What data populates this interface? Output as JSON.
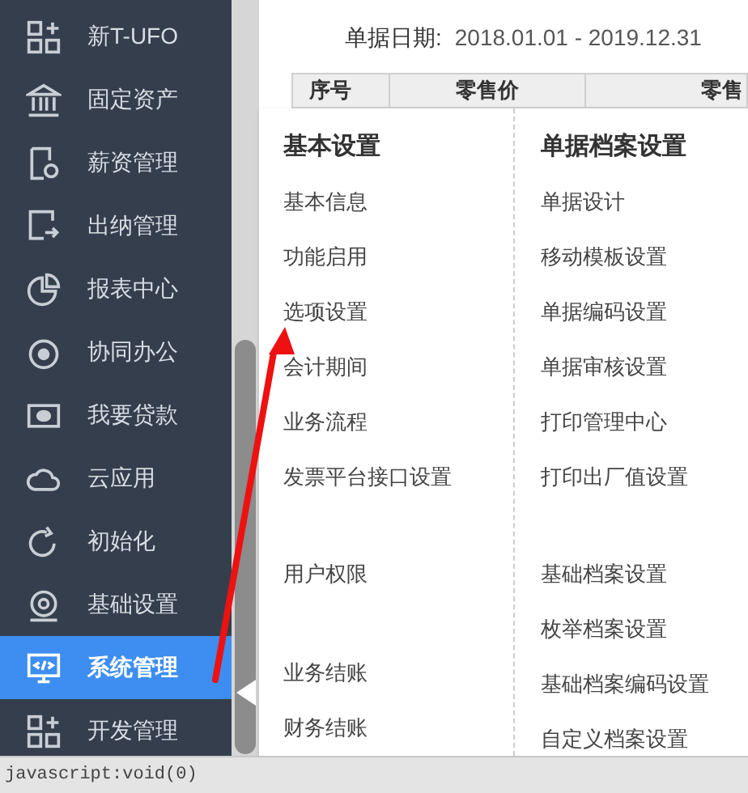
{
  "sidebar": {
    "items": [
      {
        "label": "新T-UFO",
        "selected": false
      },
      {
        "label": "固定资产",
        "selected": false
      },
      {
        "label": "薪资管理",
        "selected": false
      },
      {
        "label": "出纳管理",
        "selected": false
      },
      {
        "label": "报表中心",
        "selected": false
      },
      {
        "label": "协同办公",
        "selected": false
      },
      {
        "label": "我要贷款",
        "selected": false
      },
      {
        "label": "云应用",
        "selected": false
      },
      {
        "label": "初始化",
        "selected": false
      },
      {
        "label": "基础设置",
        "selected": false
      },
      {
        "label": "系统管理",
        "selected": true
      },
      {
        "label": "开发管理",
        "selected": false
      }
    ]
  },
  "report": {
    "date_label": "单据日期:",
    "date_range": "2018.01.01 - 2019.12.31",
    "columns": [
      "序号",
      "零售价",
      "零售"
    ]
  },
  "menu": {
    "columns": [
      {
        "title": "基本设置",
        "groups": [
          [
            "基本信息",
            "功能启用",
            "选项设置",
            "会计期间",
            "业务流程",
            "发票平台接口设置"
          ],
          [
            "用户权限"
          ],
          [
            "业务结账",
            "财务结账"
          ]
        ]
      },
      {
        "title": "单据档案设置",
        "groups": [
          [
            "单据设计",
            "移动模板设置",
            "单据编码设置",
            "单据审核设置",
            "打印管理中心",
            "打印出厂值设置"
          ],
          [
            "基础档案设置",
            "枚举档案设置",
            "基础档案编码设置",
            "自定义档案设置"
          ]
        ]
      }
    ]
  },
  "status_bar": "javascript:void(0)"
}
